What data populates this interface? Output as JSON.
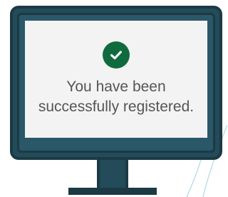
{
  "screen": {
    "icon": "check-circle-icon",
    "message_line1": "You have been",
    "message_line2": "successfully registered."
  },
  "colors": {
    "monitor_frame": "#1b3a44",
    "monitor_fill": "#234b5a",
    "screen_bg": "#f3f3f3",
    "success_green": "#0f6b3e",
    "text": "#555555",
    "decor_lines": "#b9dde6"
  }
}
